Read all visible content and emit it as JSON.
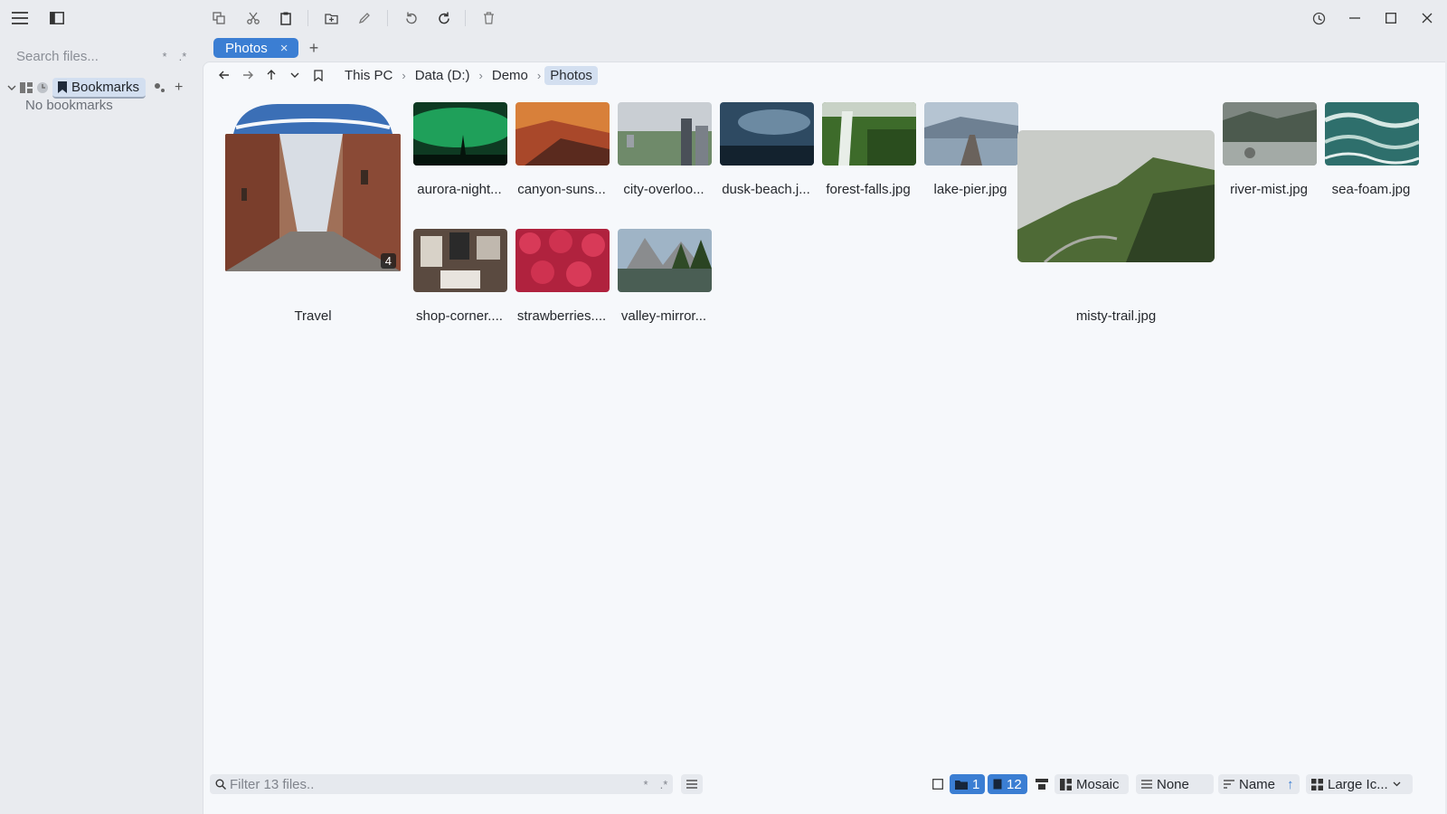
{
  "sidebar": {
    "search_placeholder": "Search files...",
    "toggle_star": "*",
    "toggle_regex": ".*",
    "bookmarks_label": "Bookmarks",
    "add_symbol": "+",
    "empty_text": "No bookmarks"
  },
  "tabs": [
    {
      "label": "Photos",
      "close": "×"
    }
  ],
  "tab_add": "+",
  "breadcrumb": [
    "This PC",
    "Data (D:)",
    "Demo",
    "Photos"
  ],
  "breadcrumb_sep": "›",
  "files": {
    "folder": {
      "name": "Travel",
      "count": "4"
    },
    "row1": [
      "aurora-night...",
      "canyon-suns...",
      "city-overloo...",
      "dusk-beach.j...",
      "forest-falls.jpg",
      "lake-pier.jpg"
    ],
    "featured": "misty-trail.jpg",
    "row1_right": [
      "river-mist.jpg",
      "sea-foam.jpg"
    ],
    "row2": [
      "shop-corner....",
      "strawberries....",
      "valley-mirror..."
    ]
  },
  "status": {
    "filter_placeholder": "Filter 13 files..",
    "toggle_star": "*",
    "toggle_regex": ".*",
    "folders_count": "1",
    "files_count": "12",
    "layout": "Mosaic",
    "group": "None",
    "sort": "Name",
    "sort_dir": "↑",
    "view": "Large Ic..."
  },
  "colors": {
    "accent": "#3b7ed3",
    "accent_light": "#d3dff0"
  }
}
